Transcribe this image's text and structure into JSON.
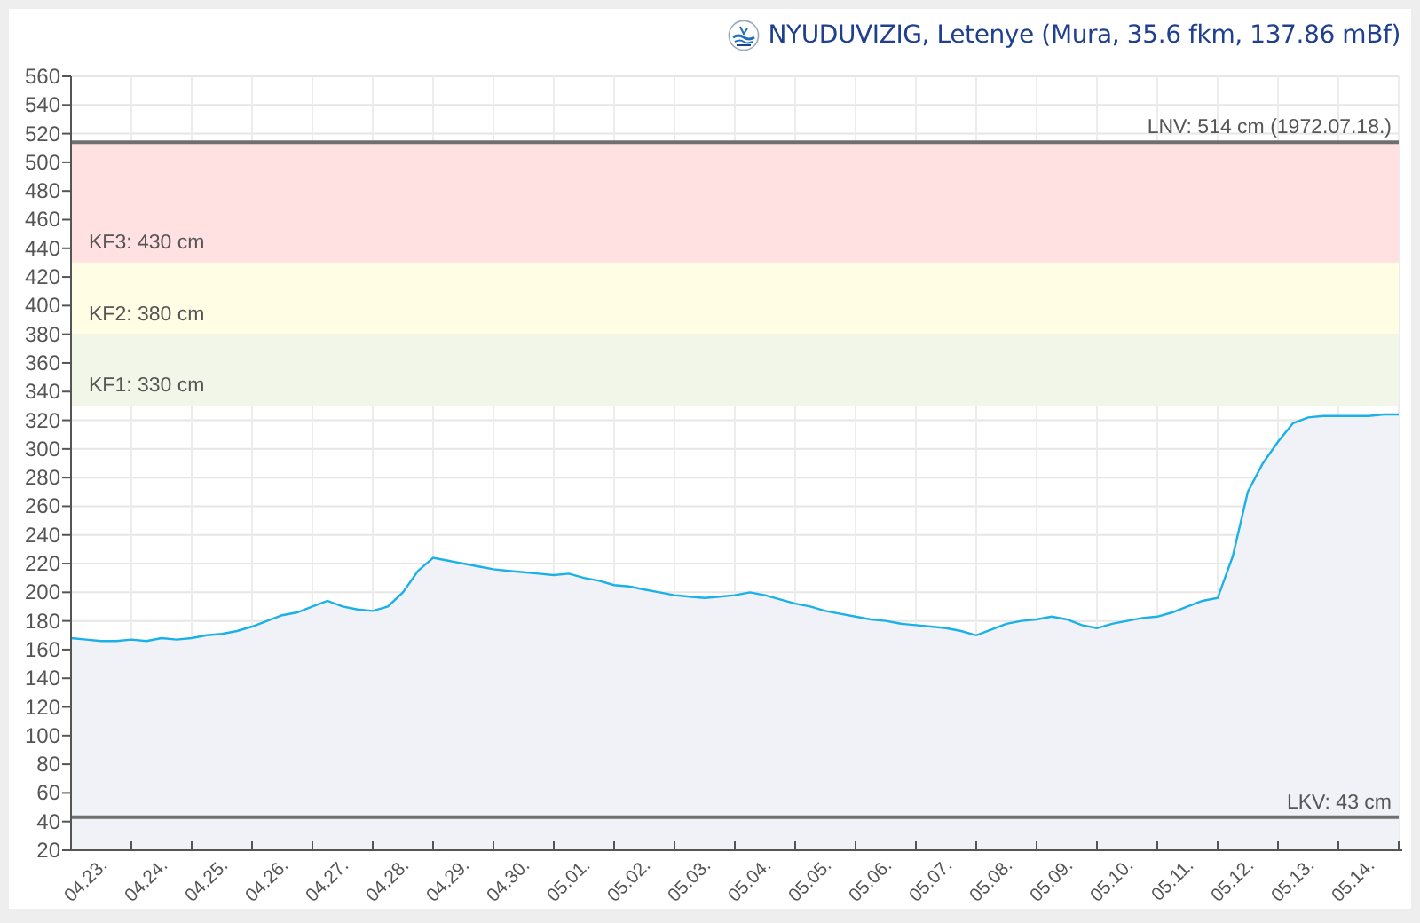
{
  "header": {
    "title": "NYUDUVIZIG, Letenye (Mura, 35.6 fkm, 137.86 mBf)"
  },
  "chart_data": {
    "type": "area",
    "ylim": [
      20,
      560
    ],
    "grid": true,
    "yticks": [
      20,
      40,
      60,
      80,
      100,
      120,
      140,
      160,
      180,
      200,
      220,
      240,
      260,
      280,
      300,
      320,
      340,
      360,
      380,
      400,
      420,
      440,
      460,
      480,
      500,
      520,
      540,
      560
    ],
    "categories": [
      null,
      null,
      "04.23.",
      null,
      null,
      null,
      "04.24.",
      null,
      null,
      null,
      "04.25.",
      null,
      null,
      null,
      "04.26.",
      null,
      null,
      null,
      "04.27.",
      null,
      null,
      null,
      "04.28.",
      null,
      null,
      null,
      "04.29.",
      null,
      null,
      null,
      "04.30.",
      null,
      null,
      null,
      "05.01.",
      null,
      null,
      null,
      "05.02.",
      null,
      null,
      null,
      "05.03.",
      null,
      null,
      null,
      "05.04.",
      null,
      null,
      null,
      "05.05.",
      null,
      null,
      null,
      "05.06.",
      null,
      null,
      null,
      "05.07.",
      null,
      null,
      null,
      "05.08.",
      null,
      null,
      null,
      "05.09.",
      null,
      null,
      null,
      "05.10.",
      null,
      null,
      null,
      "05.11.",
      null,
      null,
      null,
      "05.12.",
      null,
      null,
      null,
      "05.13.",
      null,
      null,
      null,
      "05.14.",
      null,
      null
    ],
    "series": [
      {
        "color": "#1ab0e8",
        "values": [
          168,
          167,
          166,
          166,
          167,
          166,
          168,
          167,
          168,
          170,
          171,
          173,
          176,
          180,
          184,
          186,
          190,
          194,
          190,
          188,
          187,
          190,
          200,
          215,
          224,
          222,
          220,
          218,
          216,
          215,
          214,
          213,
          212,
          213,
          210,
          208,
          205,
          204,
          202,
          200,
          198,
          197,
          196,
          197,
          198,
          200,
          198,
          195,
          192,
          190,
          187,
          185,
          183,
          181,
          180,
          178,
          177,
          176,
          175,
          173,
          170,
          174,
          178,
          180,
          181,
          183,
          181,
          177,
          175,
          178,
          180,
          182,
          183,
          186,
          190,
          194,
          196,
          225,
          270,
          290,
          305,
          318,
          322,
          323,
          323,
          323,
          323,
          324,
          324
        ]
      }
    ],
    "bands": [
      {
        "axis": "y",
        "from": 430,
        "to": 514,
        "color": "#ffe1e1",
        "label": "KF3: 430 cm"
      },
      {
        "axis": "y",
        "from": 380,
        "to": 430,
        "color": "#fffde3",
        "label": "KF2: 380 cm"
      },
      {
        "axis": "y",
        "from": 330,
        "to": 380,
        "color": "#f1f6e8",
        "label": "KF1: 330 cm"
      }
    ],
    "ref_lines": [
      {
        "axis": "y",
        "value": 514,
        "color": "#6f6f6f",
        "label": "LNV: 514 cm (1972.07.18.)"
      },
      {
        "axis": "y",
        "value": 43,
        "color": "#6f6f6f",
        "label": "LKV: 43 cm"
      }
    ]
  }
}
